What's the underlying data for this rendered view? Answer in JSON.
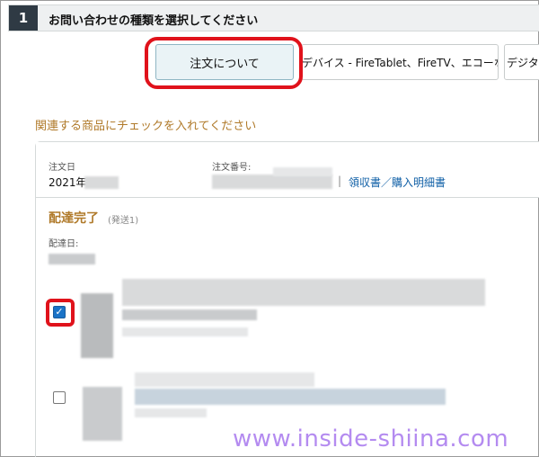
{
  "step": {
    "number": "1",
    "title": "お問い合わせの種類を選択してください"
  },
  "tabs": [
    {
      "label": "注文について",
      "selected": true
    },
    {
      "label": "デバイス - FireTablet、FireTV、エコーなど",
      "selected": false
    },
    {
      "label": "デジタル",
      "selected": false
    }
  ],
  "instruction": "関連する商品にチェックを入れてください",
  "order": {
    "date_label": "注文日",
    "date_value": "2021年",
    "number_label": "注文番号:",
    "separator": "|",
    "receipt_link": "領収書／購入明細書",
    "status": "配達完了",
    "status_sub": "(発送1)",
    "delivery_label": "配達日:"
  },
  "items": [
    {
      "checked": true
    },
    {
      "checked": false
    }
  ],
  "checkmark": "✓",
  "watermark": "www.inside-shiina.com",
  "colors": {
    "highlight": "#e0121b",
    "accent_gold": "#b07a2a",
    "link_blue": "#0f5fa6",
    "checkbox_blue": "#1a73c7",
    "watermark_purple": "#b48bf0"
  }
}
